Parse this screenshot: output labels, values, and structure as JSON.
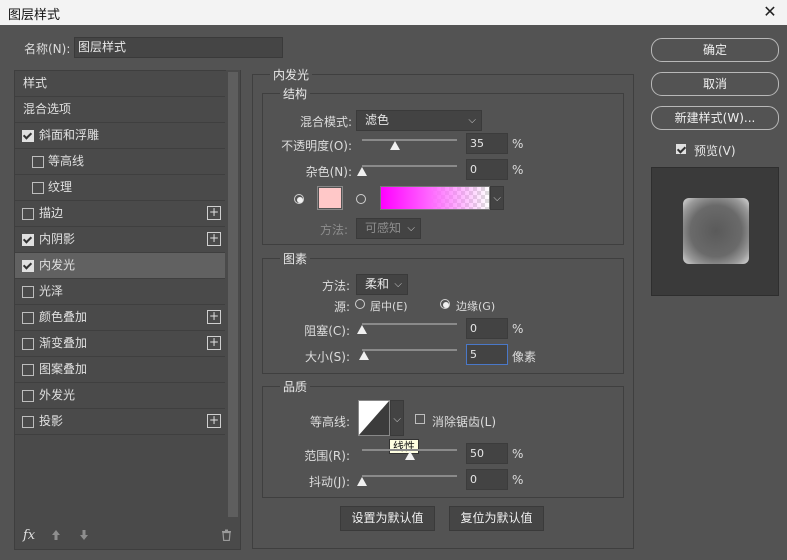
{
  "window": {
    "title": "图层样式",
    "close_glyph": "✕"
  },
  "name_label": "名称(N):",
  "name_value": "图层样式",
  "sidebar": {
    "items": [
      {
        "label": "样式"
      },
      {
        "label": "混合选项"
      },
      {
        "label": "斜面和浮雕",
        "checked": true
      },
      {
        "label": "等高线",
        "checked": false
      },
      {
        "label": "纹理",
        "checked": false
      },
      {
        "label": "描边",
        "checked": false
      },
      {
        "label": "内阴影",
        "checked": true
      },
      {
        "label": "内发光",
        "checked": true,
        "selected": true
      },
      {
        "label": "光泽",
        "checked": false
      },
      {
        "label": "颜色叠加",
        "checked": false
      },
      {
        "label": "渐变叠加",
        "checked": false
      },
      {
        "label": "图案叠加",
        "checked": false
      },
      {
        "label": "外发光",
        "checked": false
      },
      {
        "label": "投影",
        "checked": false
      }
    ],
    "fx_label": "fx",
    "plus_glyph": "+"
  },
  "panel": {
    "section_title": "内发光",
    "structure": {
      "title": "结构",
      "blend_mode_label": "混合模式:",
      "blend_mode_value": "滤色",
      "opacity_label": "不透明度(O):",
      "opacity_value": "35",
      "noise_label": "杂色(N):",
      "noise_value": "0",
      "unit_percent": "%",
      "method_label": "方法:",
      "method_value": "可感知",
      "glow_color": "#ffc8c8",
      "gradient_colors": [
        "#ff00ff",
        "#ff66ff"
      ]
    },
    "elements": {
      "title": "图素",
      "method_label": "方法:",
      "method_value": "柔和",
      "source_label": "源:",
      "source_center": "居中(E)",
      "source_edge": "边缘(G)",
      "choke_label": "阻塞(C):",
      "choke_value": "0",
      "size_label": "大小(S):",
      "size_value": "5",
      "size_unit": "像素"
    },
    "quality": {
      "title": "品质",
      "contour_label": "等高线:",
      "antialias_label": "消除锯齿(L)",
      "tooltip": "线性",
      "range_label": "范围(R):",
      "range_value": "50",
      "jitter_label": "抖动(J):",
      "jitter_value": "0"
    },
    "set_default": "设置为默认值",
    "reset_default": "复位为默认值"
  },
  "buttons": {
    "ok": "确定",
    "cancel": "取消",
    "new_style": "新建样式(W)...",
    "preview_label": "预览(V)"
  },
  "sliders": {
    "opacity": 35,
    "noise": 0,
    "choke": 0,
    "size": 5,
    "range": 50,
    "jitter": 0
  }
}
